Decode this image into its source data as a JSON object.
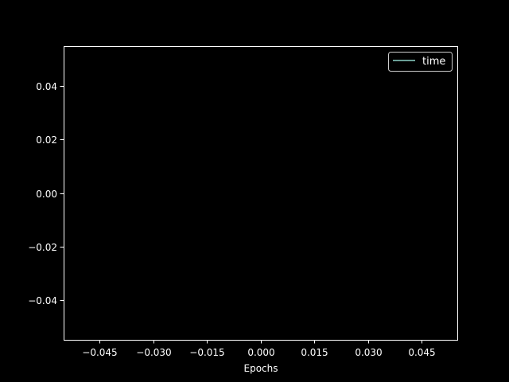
{
  "chart_data": {
    "type": "line",
    "xlabel": "Epochs",
    "ylabel": "",
    "xlim": [
      -0.055,
      0.055
    ],
    "ylim": [
      -0.055,
      0.055
    ],
    "x_ticks": [
      -0.045,
      -0.03,
      -0.015,
      0.0,
      0.015,
      0.03,
      0.045
    ],
    "x_tick_labels": [
      "−0.045",
      "−0.030",
      "−0.015",
      "0.000",
      "0.015",
      "0.030",
      "0.045"
    ],
    "y_ticks": [
      0.04,
      0.02,
      0.0,
      -0.02,
      -0.04
    ],
    "y_tick_labels": [
      "0.04",
      "0.02",
      "0.00",
      "−0.02",
      "−0.04"
    ],
    "grid": false,
    "legend_position": "top-right",
    "series": [
      {
        "name": "time",
        "x": [],
        "y": [],
        "color": "#8dd3c7"
      }
    ]
  },
  "colors": {
    "background": "#000000",
    "foreground": "#ffffff",
    "series": "#8dd3c7"
  }
}
